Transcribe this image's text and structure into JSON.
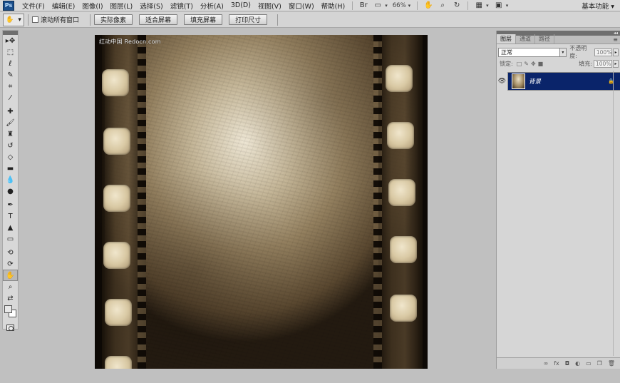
{
  "app": {
    "logo_text": "Ps"
  },
  "menubar": {
    "items": [
      "文件(F)",
      "编辑(E)",
      "图像(I)",
      "图层(L)",
      "选择(S)",
      "滤镜(T)",
      "分析(A)",
      "3D(D)",
      "视图(V)",
      "窗口(W)",
      "帮助(H)"
    ],
    "zoom": "66%",
    "workspace": "基本功能"
  },
  "options": {
    "scroll_all_label": "滚动所有窗口",
    "buttons": [
      "实际像素",
      "适合屏幕",
      "填充屏幕",
      "打印尺寸"
    ]
  },
  "canvas": {
    "watermark": "红动中国 Redocn.com"
  },
  "layers_panel": {
    "tabs": [
      "图层",
      "通道",
      "路径"
    ],
    "blend_mode": "正常",
    "opacity_label": "不透明度:",
    "opacity_value": "100%",
    "lock_label": "锁定:",
    "fill_label": "填充:",
    "fill_value": "100%",
    "layers": [
      {
        "name": "背景"
      }
    ]
  }
}
